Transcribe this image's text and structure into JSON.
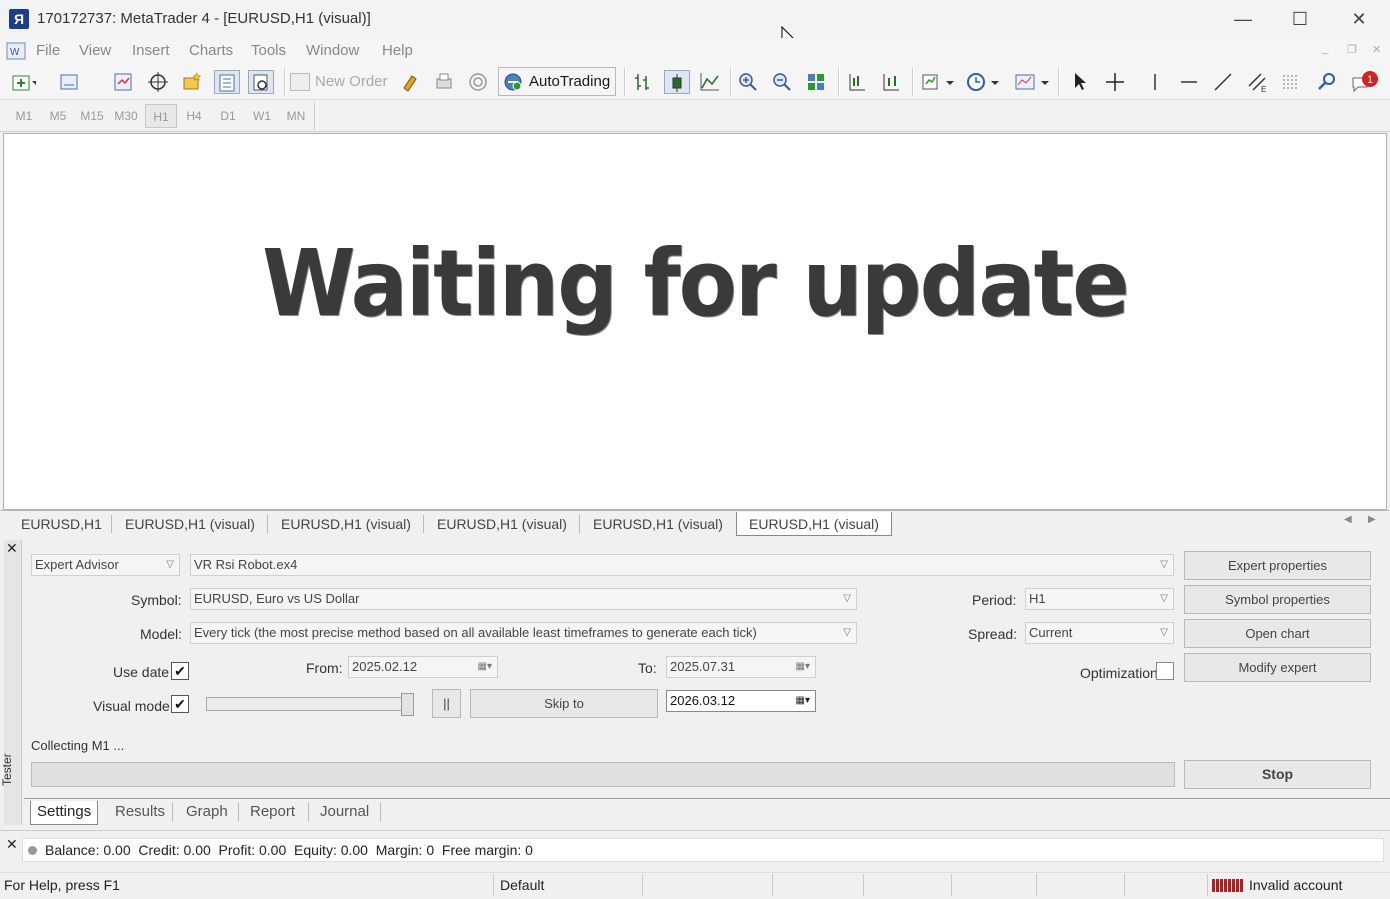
{
  "window": {
    "title": "170172737: MetaTrader 4 - [EURUSD,H1 (visual)]",
    "logo": "Я",
    "min": "—",
    "max": "☐",
    "close": "✕"
  },
  "menu": [
    "File",
    "View",
    "Insert",
    "Charts",
    "Tools",
    "Window",
    "Help"
  ],
  "toolbar": {
    "new_order": "New Order",
    "autotrading": "AutoTrading",
    "notification_count": "1"
  },
  "timeframes": [
    "M1",
    "M5",
    "M15",
    "M30",
    "H1",
    "H4",
    "D1",
    "W1",
    "MN"
  ],
  "active_timeframe": "H1",
  "chart": {
    "message": "Waiting for update"
  },
  "chart_tabs": [
    "EURUSD,H1",
    "EURUSD,H1 (visual)",
    "EURUSD,H1 (visual)",
    "EURUSD,H1 (visual)",
    "EURUSD,H1 (visual)",
    "EURUSD,H1 (visual)"
  ],
  "tester": {
    "side_label": "Tester",
    "type": "Expert Advisor",
    "expert": "VR Rsi Robot.ex4",
    "symbol_label": "Symbol:",
    "symbol": "EURUSD, Euro vs US Dollar",
    "period_label": "Period:",
    "period": "H1",
    "model_label": "Model:",
    "model": "Every tick (the most precise method based on all available least timeframes to generate each tick)",
    "spread_label": "Spread:",
    "spread": "Current",
    "use_date_label": "Use date",
    "from_label": "From:",
    "from": "2025.02.12",
    "to_label": "To:",
    "to": "2025.07.31",
    "optimization_label": "Optimization",
    "visual_mode_label": "Visual mode",
    "pause": "||",
    "skip_to": "Skip to",
    "skip_date": "2026.03.12",
    "status": "Collecting M1 ...",
    "expert_properties": "Expert properties",
    "symbol_properties": "Symbol properties",
    "open_chart": "Open chart",
    "modify_expert": "Modify expert",
    "stop": "Stop",
    "check": "✔",
    "tabs": [
      "Settings",
      "Results",
      "Graph",
      "Report",
      "Journal"
    ]
  },
  "account": {
    "text": "Balance: 0.00  Credit: 0.00  Profit: 0.00  Equity: 0.00  Margin: 0  Free margin: 0"
  },
  "statusbar": {
    "help": "For Help, press F1",
    "profile": "Default",
    "connection": "Invalid account"
  }
}
